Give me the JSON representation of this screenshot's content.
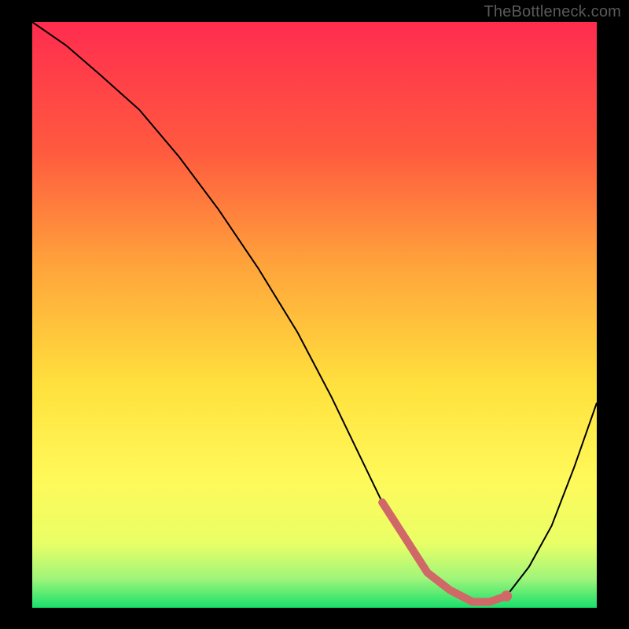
{
  "watermark": "TheBottleneck.com",
  "colors": {
    "background": "#000000",
    "gradient_top": "#ff2c4f",
    "gradient_mid_high": "#ff6a3c",
    "gradient_mid": "#ffd23d",
    "gradient_mid_low": "#fff95a",
    "gradient_bottom": "#19e06b",
    "curve": "#000000",
    "marker": "#d16868"
  },
  "chart_data": {
    "type": "line",
    "title": "",
    "xlabel": "",
    "ylabel": "",
    "xlim": [
      0,
      100
    ],
    "ylim": [
      0,
      100
    ],
    "grid": false,
    "legend": false,
    "series": [
      {
        "name": "bottleneck-curve",
        "x": [
          0,
          6,
          12,
          19,
          26,
          33,
          40,
          47,
          53,
          58,
          62,
          66,
          70,
          74,
          78,
          81,
          84,
          88,
          92,
          96,
          100
        ],
        "values": [
          100,
          96,
          91,
          85,
          77,
          68,
          58,
          47,
          36,
          26,
          18,
          12,
          6,
          3,
          1,
          1,
          2,
          7,
          14,
          24,
          35
        ]
      }
    ],
    "highlight": {
      "name": "optimal-range",
      "x": [
        62,
        66,
        70,
        74,
        78,
        81,
        84
      ],
      "values": [
        18,
        12,
        6,
        3,
        1,
        1,
        2
      ],
      "end_dot": {
        "x": 84,
        "value": 2
      }
    }
  }
}
